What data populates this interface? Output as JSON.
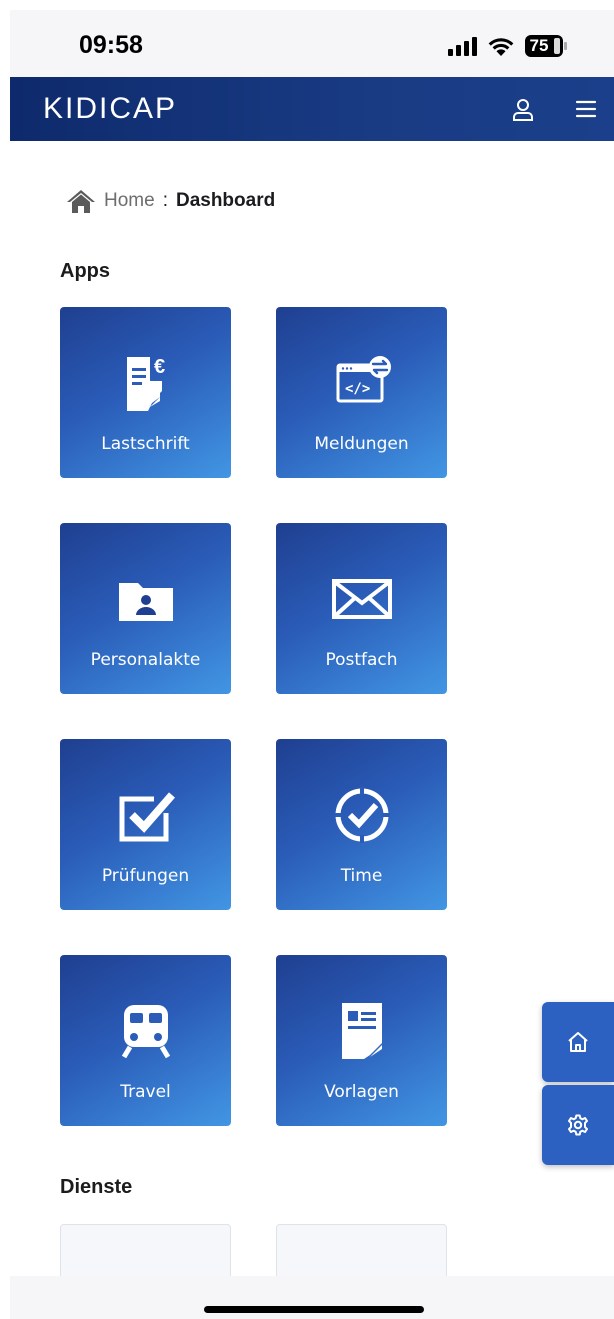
{
  "status_bar": {
    "time": "09:58",
    "battery": "75"
  },
  "header": {
    "logo": "KIDICAP"
  },
  "breadcrumb": {
    "home": "Home",
    "separator": ":",
    "current": "Dashboard"
  },
  "sections": {
    "apps_title": "Apps",
    "dienste_title": "Dienste"
  },
  "apps": [
    {
      "label": "Lastschrift",
      "icon": "invoice-euro-icon"
    },
    {
      "label": "Meldungen",
      "icon": "code-transfer-icon"
    },
    {
      "label": "Personalakte",
      "icon": "personnel-folder-icon"
    },
    {
      "label": "Postfach",
      "icon": "envelope-icon"
    },
    {
      "label": "Prüfungen",
      "icon": "checkbox-icon"
    },
    {
      "label": "Time",
      "icon": "clock-check-icon"
    },
    {
      "label": "Travel",
      "icon": "train-icon"
    },
    {
      "label": "Vorlagen",
      "icon": "template-document-icon"
    }
  ],
  "theme": {
    "header_bg": "#0e2a6c",
    "tile_start": "#1f3f90",
    "tile_end": "#4296e4",
    "fab_bg": "#2c61c2"
  }
}
